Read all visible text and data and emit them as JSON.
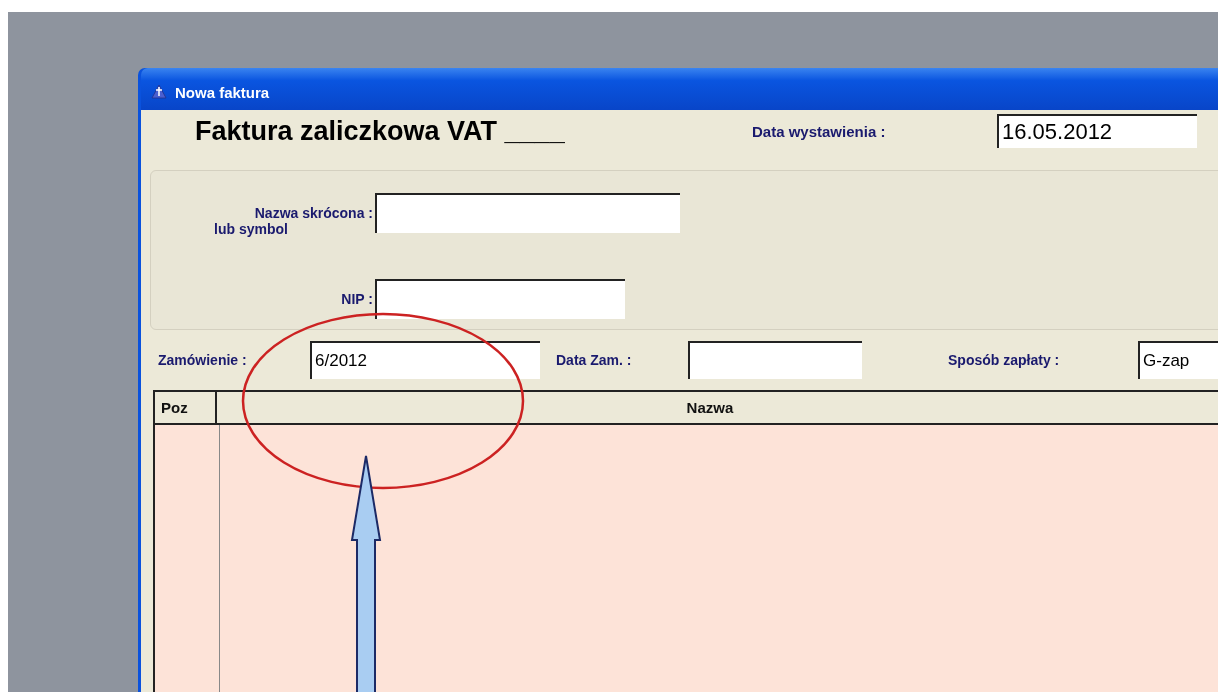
{
  "window": {
    "title": "Nowa faktura"
  },
  "header": {
    "title": "Faktura zaliczkowa VAT ____",
    "date_label": "Data wystawienia :",
    "date_value": "16.05.2012"
  },
  "customer": {
    "short_name_label": "Nazwa skrócona :",
    "short_name_sublabel": "lub symbol",
    "nip_label": "NIP :"
  },
  "order": {
    "number_label": "Zamówienie :",
    "number_value": "6/2012",
    "date_label": "Data Zam. :",
    "payment_label": "Sposób zapłaty :",
    "payment_value": "G-zap"
  },
  "table": {
    "columns": [
      "Poz",
      "Nazwa"
    ]
  }
}
